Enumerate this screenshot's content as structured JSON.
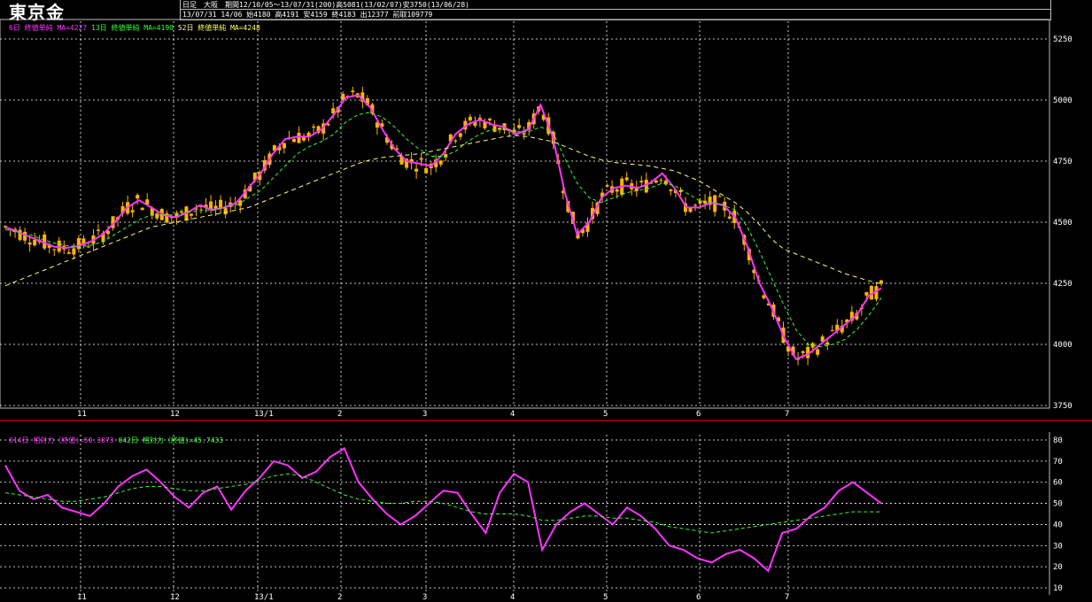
{
  "title": "東京金",
  "info": {
    "line1": "日足　大阪　期間12/10/05～13/07/31(200)高5081(13/02/07)安3750(13/06/28)",
    "line2": "13/07/31 14/06 始4180 高4191 安4159 終4183 出12377 前取109779"
  },
  "legend_top": {
    "ma1": "6日 終値単純 MA=4227",
    "ma2": "13日 終値単純 MA=4190",
    "ma3": "52日 終値単純 MA=4248"
  },
  "legend_bottom": {
    "s1": "014日 相対力（終値)=50.3073",
    "s2": "042日 相対力（終値)=45.7433"
  },
  "colors": {
    "candle": "#ffb300",
    "ma1": "#ff33ff",
    "ma2": "#33ff33",
    "ma3": "#ffff66",
    "rsi14": "#ff33ff",
    "rsi42": "#33ff33",
    "grid": "#ffffff",
    "separator": "#ff0000"
  },
  "chart_data": [
    {
      "type": "candlestick",
      "title": "東京金",
      "x_tick_labels": [
        "11",
        "12",
        "13/1",
        "2",
        "3",
        "4",
        "5",
        "6",
        "7"
      ],
      "y_ticks": [
        3750,
        4000,
        4250,
        4500,
        4750,
        5000,
        5250
      ],
      "ylim": [
        3750,
        5280
      ],
      "grid": true,
      "series": [
        {
          "name": "6日 終値単純 MA=4227",
          "type": "line",
          "values": [
            4480,
            4462,
            4440,
            4420,
            4400,
            4395,
            4402,
            4420,
            4450,
            4500,
            4560,
            4590,
            4560,
            4530,
            4520,
            4540,
            4570,
            4550,
            4560,
            4580,
            4640,
            4700,
            4780,
            4840,
            4850,
            4850,
            4880,
            4940,
            5010,
            5020,
            4970,
            4880,
            4800,
            4750,
            4740,
            4730,
            4780,
            4860,
            4900,
            4920,
            4900,
            4890,
            4860,
            4880,
            4980,
            4850,
            4620,
            4450,
            4500,
            4600,
            4640,
            4650,
            4640,
            4660,
            4700,
            4640,
            4560,
            4560,
            4580,
            4570,
            4520,
            4400,
            4250,
            4150,
            4030,
            3940,
            3960,
            4000,
            4040,
            4080,
            4120,
            4200,
            4230
          ]
        },
        {
          "name": "13日 終値単純 MA=4190",
          "type": "line",
          "values": [
            4470,
            4460,
            4450,
            4430,
            4415,
            4405,
            4400,
            4405,
            4420,
            4450,
            4480,
            4510,
            4530,
            4530,
            4530,
            4540,
            4550,
            4550,
            4560,
            4570,
            4600,
            4630,
            4680,
            4730,
            4780,
            4810,
            4830,
            4860,
            4910,
            4940,
            4950,
            4930,
            4890,
            4840,
            4800,
            4770,
            4770,
            4790,
            4830,
            4860,
            4880,
            4880,
            4870,
            4870,
            4890,
            4870,
            4760,
            4660,
            4600,
            4580,
            4600,
            4620,
            4630,
            4640,
            4660,
            4650,
            4620,
            4590,
            4580,
            4570,
            4550,
            4480,
            4380,
            4270,
            4160,
            4060,
            4000,
            3990,
            4000,
            4020,
            4060,
            4120,
            4190
          ]
        },
        {
          "name": "52日 終値単純 MA=4248",
          "type": "line",
          "values": [
            4240,
            4260,
            4280,
            4300,
            4320,
            4340,
            4360,
            4380,
            4400,
            4420,
            4440,
            4460,
            4480,
            4490,
            4500,
            4510,
            4520,
            4530,
            4540,
            4550,
            4560,
            4580,
            4600,
            4620,
            4640,
            4660,
            4680,
            4700,
            4720,
            4740,
            4755,
            4765,
            4770,
            4775,
            4780,
            4790,
            4800,
            4810,
            4820,
            4830,
            4840,
            4850,
            4855,
            4850,
            4840,
            4830,
            4810,
            4790,
            4770,
            4755,
            4745,
            4740,
            4735,
            4730,
            4720,
            4710,
            4690,
            4670,
            4640,
            4610,
            4580,
            4540,
            4490,
            4430,
            4390,
            4370,
            4350,
            4330,
            4310,
            4290,
            4275,
            4260,
            4248
          ]
        }
      ]
    },
    {
      "type": "line",
      "x_tick_labels": [
        "11",
        "12",
        "13/1",
        "2",
        "3",
        "4",
        "5",
        "6",
        "7"
      ],
      "y_ticks": [
        10,
        20,
        30,
        40,
        50,
        60,
        70,
        80
      ],
      "ylim": [
        10,
        80
      ],
      "grid": true,
      "series": [
        {
          "name": "014日 相対力（終値)=50.3073",
          "values": [
            68,
            56,
            52,
            54,
            48,
            46,
            44,
            50,
            58,
            63,
            66,
            60,
            53,
            48,
            55,
            58,
            47,
            56,
            62,
            70,
            68,
            62,
            65,
            72,
            76,
            60,
            52,
            45,
            40,
            44,
            50,
            56,
            55,
            45,
            36,
            55,
            64,
            60,
            28,
            40,
            46,
            50,
            45,
            40,
            48,
            44,
            38,
            30,
            28,
            24,
            22,
            26,
            28,
            24,
            18,
            36,
            38,
            44,
            48,
            56,
            60,
            55,
            50
          ]
        },
        {
          "name": "042日 相対力（終値)=45.7433",
          "values": [
            55,
            54,
            53,
            52,
            51,
            51,
            52,
            53,
            55,
            57,
            58,
            58,
            57,
            56,
            56,
            57,
            58,
            59,
            61,
            63,
            64,
            63,
            60,
            57,
            54,
            52,
            51,
            50,
            50,
            51,
            51,
            50,
            48,
            46,
            45,
            45,
            45,
            44,
            42,
            42,
            43,
            44,
            44,
            43,
            43,
            42,
            41,
            39,
            38,
            37,
            36,
            37,
            38,
            39,
            40,
            41,
            42,
            43,
            44,
            45,
            46,
            46,
            46
          ]
        }
      ]
    }
  ]
}
